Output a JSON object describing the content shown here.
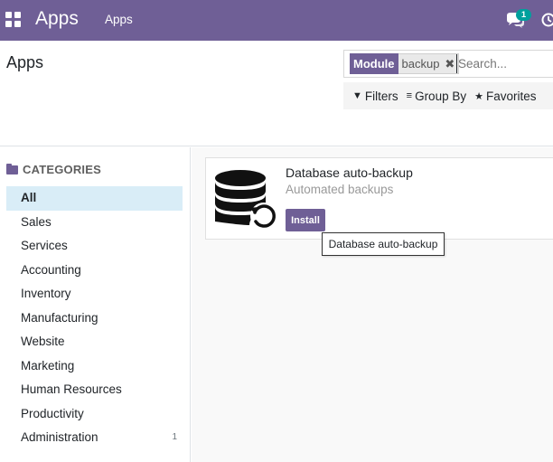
{
  "colors": {
    "brand": "#6f5f96",
    "badge": "#00a09d",
    "active_category_bg": "#d9edf7"
  },
  "navbar": {
    "brand": "Apps",
    "menu_item": "Apps",
    "chat_badge_count": "1",
    "icons": [
      "apps-grid-icon",
      "chat-icon",
      "clock-icon"
    ]
  },
  "control_panel": {
    "title": "Apps",
    "search": {
      "facet_label": "Module",
      "facet_value": "backup",
      "remove_icon": "✖",
      "placeholder": "Search...",
      "value": ""
    },
    "options": {
      "filters": "Filters",
      "group_by": "Group By",
      "favorites": "Favorites"
    }
  },
  "sidebar": {
    "header": "CATEGORIES",
    "items": [
      {
        "label": "All",
        "active": true,
        "count": ""
      },
      {
        "label": "Sales",
        "count": ""
      },
      {
        "label": "Services",
        "count": ""
      },
      {
        "label": "Accounting",
        "count": ""
      },
      {
        "label": "Inventory",
        "count": ""
      },
      {
        "label": "Manufacturing",
        "count": ""
      },
      {
        "label": "Website",
        "count": ""
      },
      {
        "label": "Marketing",
        "count": ""
      },
      {
        "label": "Human Resources",
        "count": ""
      },
      {
        "label": "Productivity",
        "count": ""
      },
      {
        "label": "Administration",
        "count": "1"
      }
    ]
  },
  "main": {
    "card": {
      "title": "Database auto-backup",
      "summary": "Automated backups",
      "install_label": "Install",
      "icon": "database-backup-icon"
    },
    "tooltip": "Database auto-backup"
  }
}
